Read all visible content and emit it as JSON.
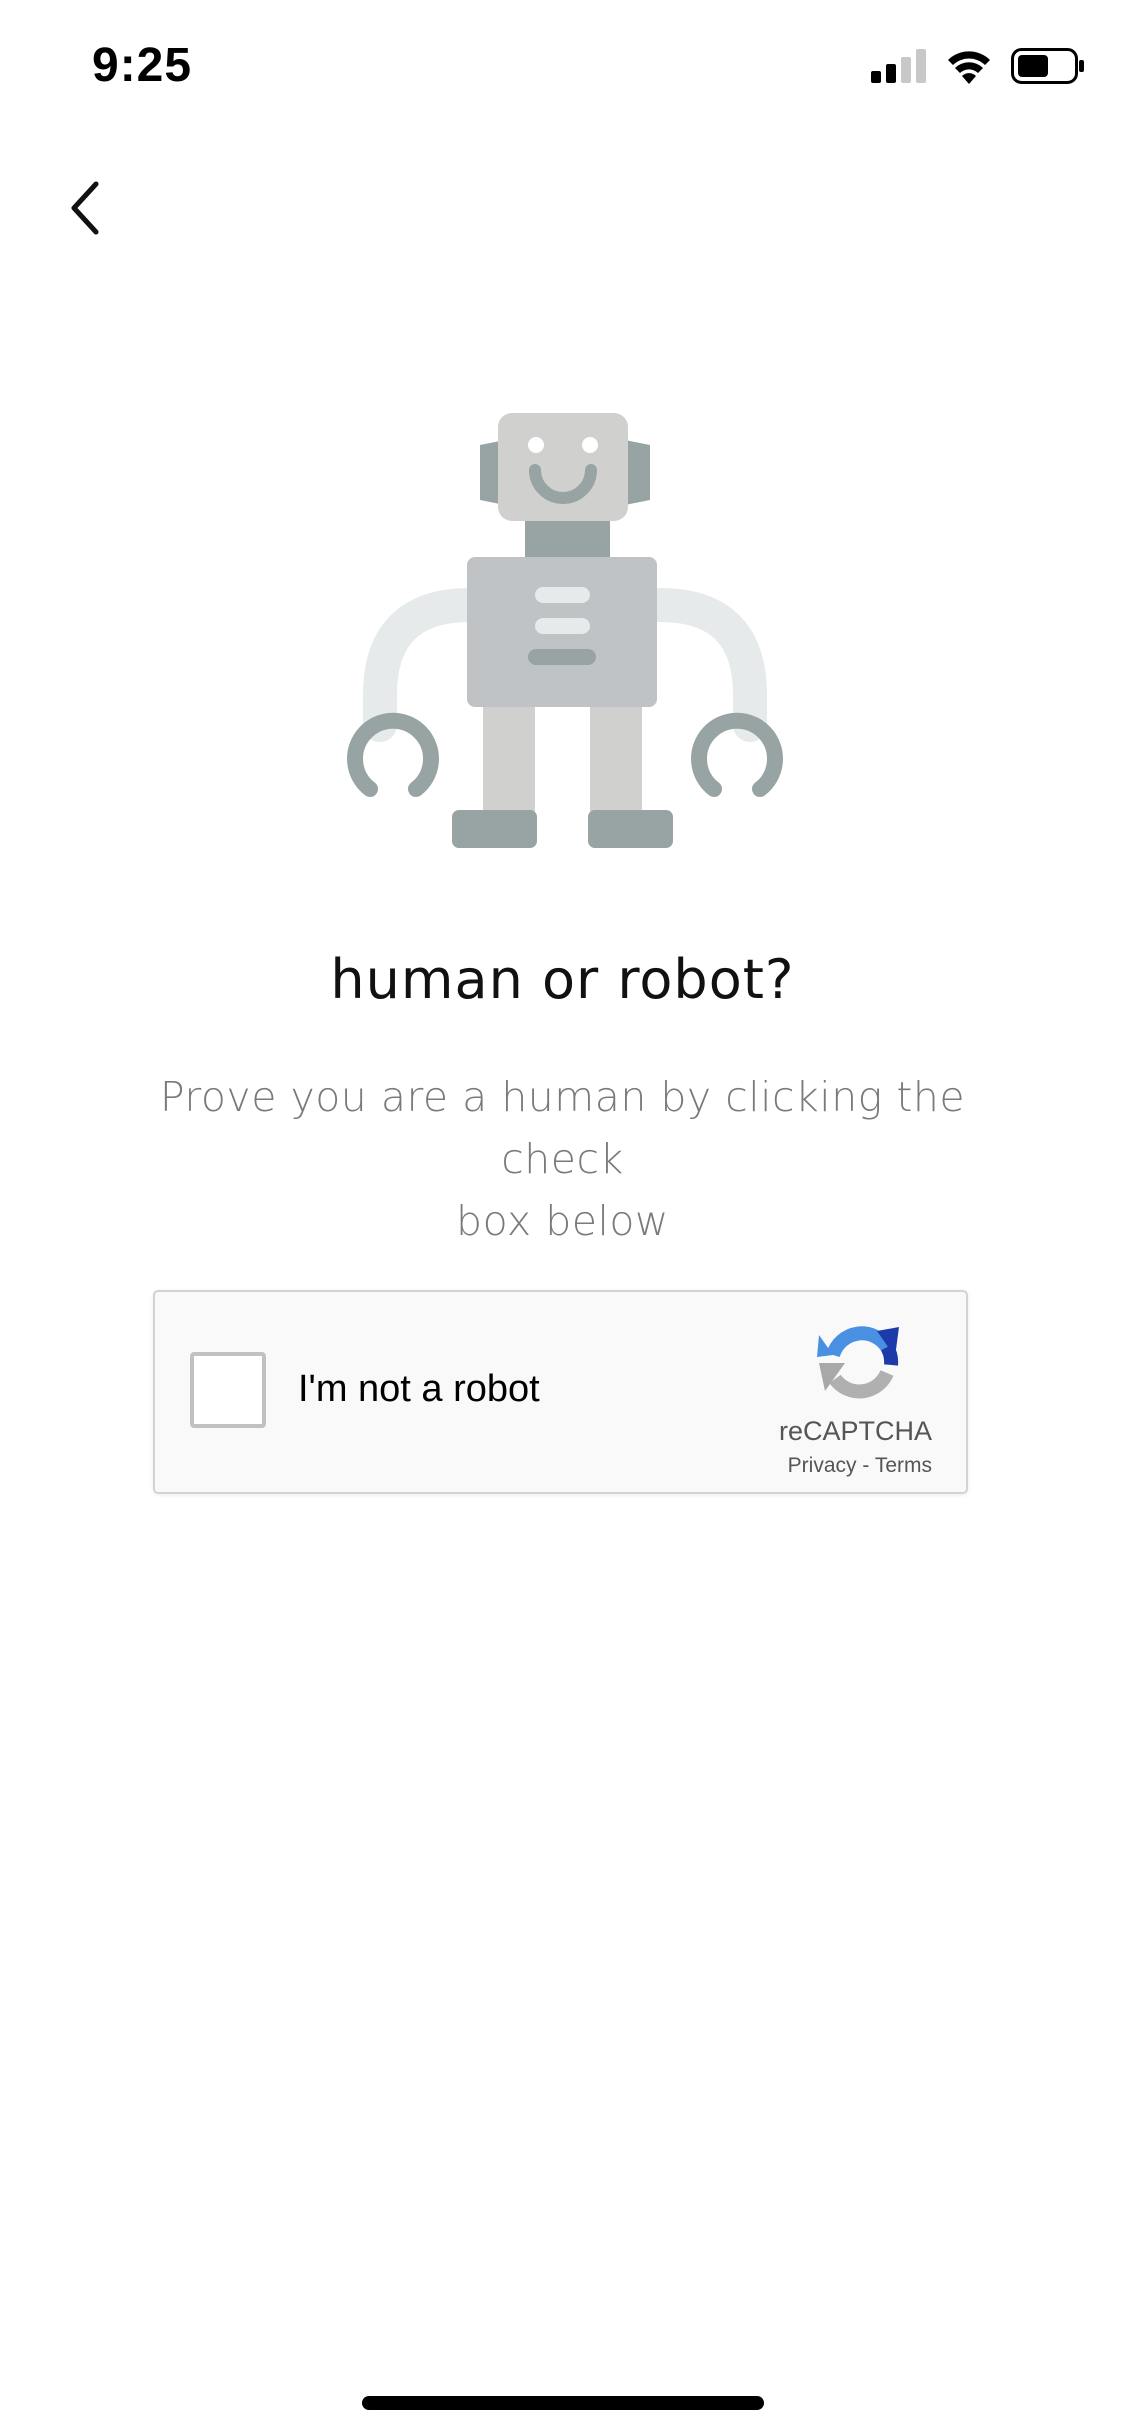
{
  "status_bar": {
    "time": "9:25",
    "signal_icon": "cellular-signal-icon",
    "wifi_icon": "wifi-icon",
    "battery_icon": "battery-icon"
  },
  "nav": {
    "back_icon": "chevron-left-icon"
  },
  "illustration": {
    "icon": "robot-illustration",
    "colors": {
      "dark_gray": "#97a4a3",
      "light_gray": "#d0d1ce",
      "body_gray": "#bfc3c5",
      "arm_gray": "#e6eaea"
    }
  },
  "main": {
    "title": "human or robot?",
    "subtitle_line1": "Prove you are a human by clicking the check",
    "subtitle_line2": "box below"
  },
  "recaptcha": {
    "checkbox_label": "I'm not a robot",
    "checked": false,
    "brand": "reCAPTCHA",
    "privacy_label": "Privacy",
    "separator": " - ",
    "terms_label": "Terms",
    "logo_icon": "recaptcha-logo-icon",
    "colors": {
      "blue": "#4a90e2",
      "dark_blue": "#1c3aa9",
      "gray": "#b0b0b0"
    }
  }
}
